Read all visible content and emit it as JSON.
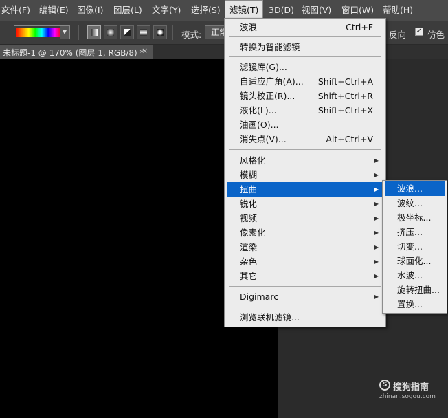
{
  "menubar": {
    "items": [
      "文件(F)",
      "编辑(E)",
      "图像(I)",
      "图层(L)",
      "文字(Y)",
      "选择(S)",
      "滤镜(T)",
      "3D(D)",
      "视图(V)",
      "窗口(W)",
      "帮助(H)"
    ]
  },
  "options": {
    "mode_label": "模式:",
    "mode_value": "正常",
    "reverse_label": "反向",
    "dither_checked": "✓",
    "dither_label": "仿色"
  },
  "document_tab": {
    "title": "未标题-1 @ 170% (图层 1, RGB/8) *",
    "close": "×"
  },
  "filter_menu": {
    "items": [
      {
        "label": "波浪",
        "shortcut": "Ctrl+F"
      },
      {
        "label": "转换为智能滤镜",
        "shortcut": ""
      },
      {
        "label": "滤镜库(G)...",
        "shortcut": ""
      },
      {
        "label": "自适应广角(A)...",
        "shortcut": "Shift+Ctrl+A"
      },
      {
        "label": "镜头校正(R)...",
        "shortcut": "Shift+Ctrl+R"
      },
      {
        "label": "液化(L)...",
        "shortcut": "Shift+Ctrl+X"
      },
      {
        "label": "油画(O)...",
        "shortcut": ""
      },
      {
        "label": "消失点(V)...",
        "shortcut": "Alt+Ctrl+V"
      },
      {
        "label": "风格化",
        "shortcut": ""
      },
      {
        "label": "模糊",
        "shortcut": ""
      },
      {
        "label": "扭曲",
        "shortcut": ""
      },
      {
        "label": "锐化",
        "shortcut": ""
      },
      {
        "label": "视频",
        "shortcut": ""
      },
      {
        "label": "像素化",
        "shortcut": ""
      },
      {
        "label": "渲染",
        "shortcut": ""
      },
      {
        "label": "杂色",
        "shortcut": ""
      },
      {
        "label": "其它",
        "shortcut": ""
      },
      {
        "label": "Digimarc",
        "shortcut": ""
      },
      {
        "label": "浏览联机滤镜...",
        "shortcut": ""
      }
    ]
  },
  "distort_submenu": {
    "items": [
      "波浪...",
      "波纹...",
      "极坐标...",
      "挤压...",
      "切变...",
      "球面化...",
      "水波...",
      "旋转扭曲...",
      "置换..."
    ]
  },
  "watermark": {
    "logo": "S",
    "text": "搜狗指南",
    "url": "zhinan.sogou.com"
  },
  "colors": {
    "highlight": "#0a64c8",
    "menu_bg": "#ececec",
    "menubar_bg": "#4a4a4a",
    "canvas": "#000000"
  }
}
